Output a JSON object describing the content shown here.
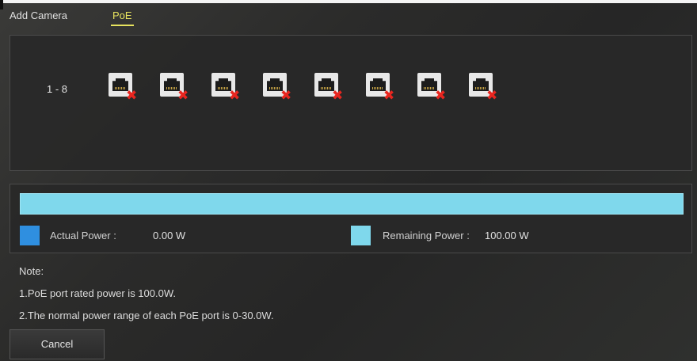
{
  "tabs": [
    {
      "label": "Add Camera",
      "active": false
    },
    {
      "label": "PoE",
      "active": true
    }
  ],
  "accent_color": "#e7e35e",
  "ports": {
    "range_label": "1 - 8",
    "items": [
      {
        "port": 1,
        "icon": "ethernet-port-disconnected-icon"
      },
      {
        "port": 2,
        "icon": "ethernet-port-disconnected-icon"
      },
      {
        "port": 3,
        "icon": "ethernet-port-disconnected-icon"
      },
      {
        "port": 4,
        "icon": "ethernet-port-disconnected-icon"
      },
      {
        "port": 5,
        "icon": "ethernet-port-disconnected-icon"
      },
      {
        "port": 6,
        "icon": "ethernet-port-disconnected-icon"
      },
      {
        "port": 7,
        "icon": "ethernet-port-disconnected-icon"
      },
      {
        "port": 8,
        "icon": "ethernet-port-disconnected-icon"
      }
    ]
  },
  "power": {
    "actual_fraction": 0.0,
    "actual_label": "Actual Power :",
    "actual_value": "0.00 W",
    "actual_color": "#2f8fe0",
    "remaining_label": "Remaining Power :",
    "remaining_value": "100.00 W",
    "remaining_color": "#7fd8ec"
  },
  "notes": {
    "title": "Note:",
    "line1": "1.PoE port rated power is 100.0W.",
    "line2": "2.The normal power range of each PoE port is 0-30.0W."
  },
  "buttons": {
    "cancel": "Cancel"
  }
}
